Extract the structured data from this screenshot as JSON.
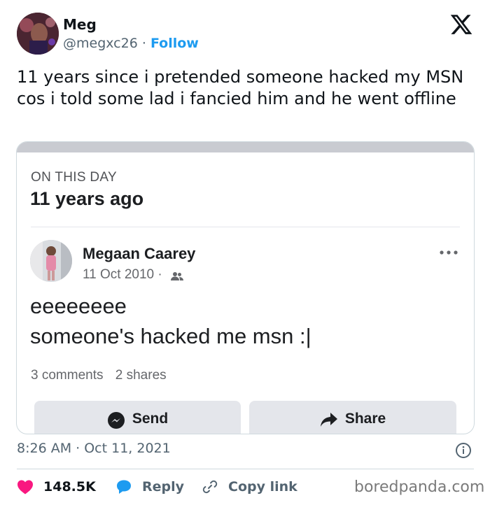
{
  "author": {
    "name": "Meg",
    "handle": "@megxc26",
    "separator": "·",
    "follow_label": "Follow"
  },
  "tweet": {
    "text": "11 years since i pretended someone hacked my MSN cos i told some lad i fancied him and he went offline",
    "timestamp": "8:26 AM · Oct 11, 2021"
  },
  "memory_card": {
    "header": "ON THIS DAY",
    "years_ago": "11 years ago",
    "post": {
      "author": "Megaan Caarey",
      "date": "11 Oct 2010 ·",
      "line1": "eeeeeeee",
      "line2": "someone's hacked me msn :|",
      "comments": "3 comments",
      "shares": "2 shares"
    },
    "buttons": {
      "send": "Send",
      "share": "Share"
    }
  },
  "actions": {
    "likes": "148.5K",
    "reply": "Reply",
    "copy_link": "Copy link"
  },
  "watermark": "boredpanda.com",
  "colors": {
    "like": "#f91880",
    "reply": "#1d9bf0",
    "follow": "#1d9bf0",
    "fb_button_bg": "#e4e6eb"
  },
  "icons": [
    "x-logo-icon",
    "friends-icon",
    "more-icon",
    "messenger-icon",
    "share-arrow-icon",
    "info-icon",
    "heart-icon",
    "reply-bubble-icon",
    "link-icon"
  ]
}
